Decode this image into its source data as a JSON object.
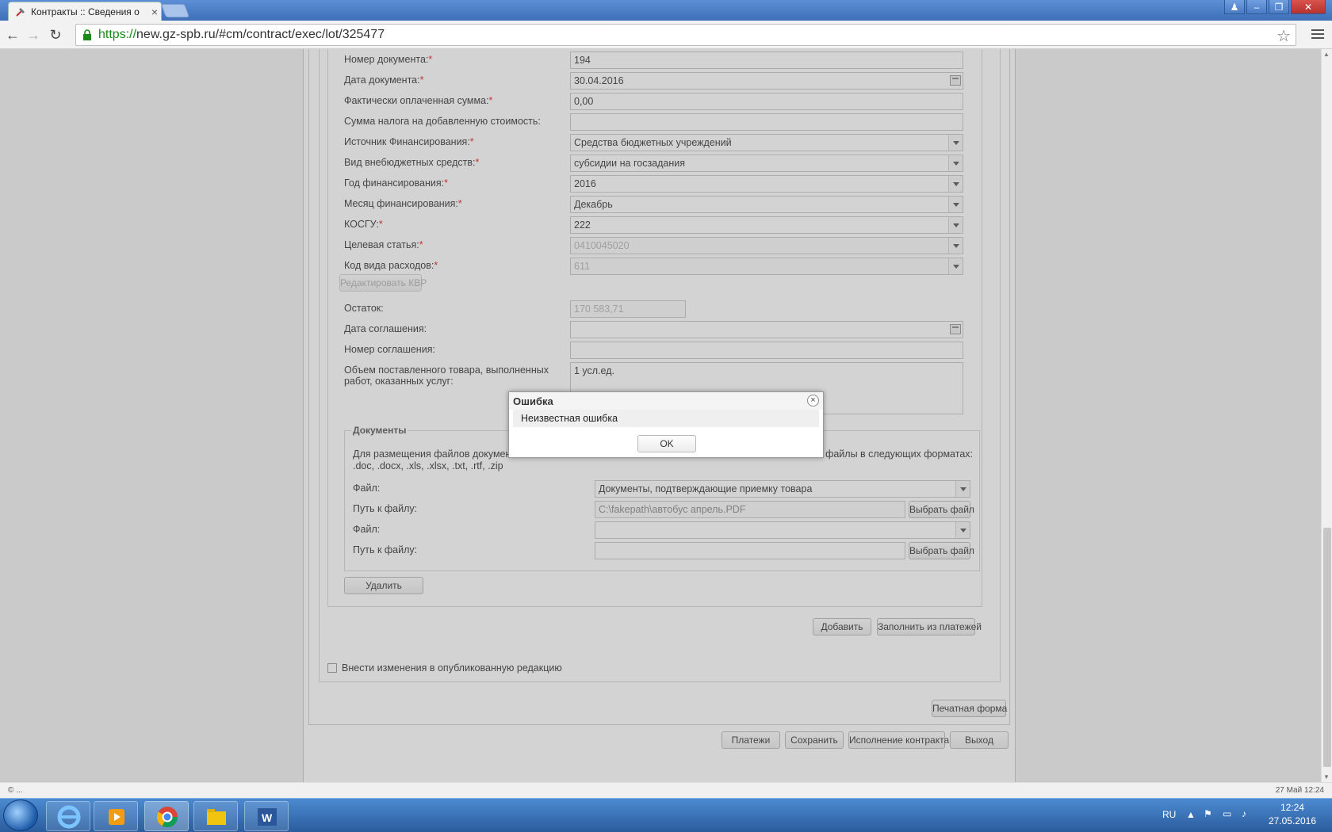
{
  "browser": {
    "tab_title": "Контракты :: Сведения о",
    "url_scheme": "https://",
    "url_rest": "new.gz-spb.ru/#cm/contract/exec/lot/325477"
  },
  "form": {
    "rows": [
      {
        "label": "Номер документа:",
        "required": true,
        "value": "194",
        "type": "text"
      },
      {
        "label": "Дата документа:",
        "required": true,
        "value": "30.04.2016",
        "type": "date"
      },
      {
        "label": "Фактически оплаченная сумма:",
        "required": true,
        "value": "0,00",
        "type": "text"
      },
      {
        "label": "Сумма налога на добавленную стоимость:",
        "required": false,
        "value": "",
        "type": "text"
      },
      {
        "label": "Источник Финансирования:",
        "required": true,
        "value": "Средства бюджетных учреждений",
        "type": "combo"
      },
      {
        "label": "Вид внебюджетных средств:",
        "required": true,
        "value": "субсидии на госзадания",
        "type": "combo"
      },
      {
        "label": "Год финансирования:",
        "required": true,
        "value": "2016",
        "type": "combo"
      },
      {
        "label": "Месяц финансирования:",
        "required": true,
        "value": "Декабрь",
        "type": "combo"
      },
      {
        "label": "КОСГУ:",
        "required": true,
        "value": "222",
        "type": "combo"
      },
      {
        "label": "Целевая статья:",
        "required": true,
        "value": "0410045020",
        "type": "combo-disabled"
      },
      {
        "label": "Код вида расходов:",
        "required": true,
        "value": "611",
        "type": "combo-disabled"
      }
    ],
    "edit_kvr_button": "Редактировать КВР",
    "remainder_label": "Остаток:",
    "remainder_value": "170 583,71",
    "agreement_date_label": "Дата соглашения:",
    "agreement_number_label": "Номер соглашения:",
    "volume_label": "Объем поставленного товара, выполненных работ, оказанных услуг:",
    "volume_value": "1 усл.ед."
  },
  "documents": {
    "legend": "Документы",
    "hint_left": "Для размещения файлов документа",
    "hint_right": "файлы в следующих форматах:",
    "hint_line2": ".doc, .docx, .xls, .xlsx, .txt, .rtf, .zip",
    "file_label": "Файл:",
    "path_label": "Путь к файлу:",
    "file1_value": "Документы, подтверждающие приемку товара",
    "path1_value": "C:\\fakepath\\автобус апрель.PDF",
    "choose_file_button": "Выбрать файл",
    "delete_button": "Удалить"
  },
  "actions": {
    "add_button": "Добавить",
    "fill_from_payments_button": "Заполнить из платежей",
    "publish_changes_label": "Внести изменения в опубликованную редакцию",
    "print_form_button": "Печатная форма",
    "payments_button": "Платежи",
    "save_button": "Сохранить",
    "execution_button": "Исполнение контракта",
    "exit_button": "Выход"
  },
  "dialog": {
    "title": "Ошибка",
    "message": "Неизвестная ошибка",
    "ok": "OK"
  },
  "status": {
    "left": "© ...",
    "right": "27 Май 12:24"
  },
  "taskbar": {
    "lang": "RU",
    "time": "12:24",
    "date": "27.05.2016"
  }
}
